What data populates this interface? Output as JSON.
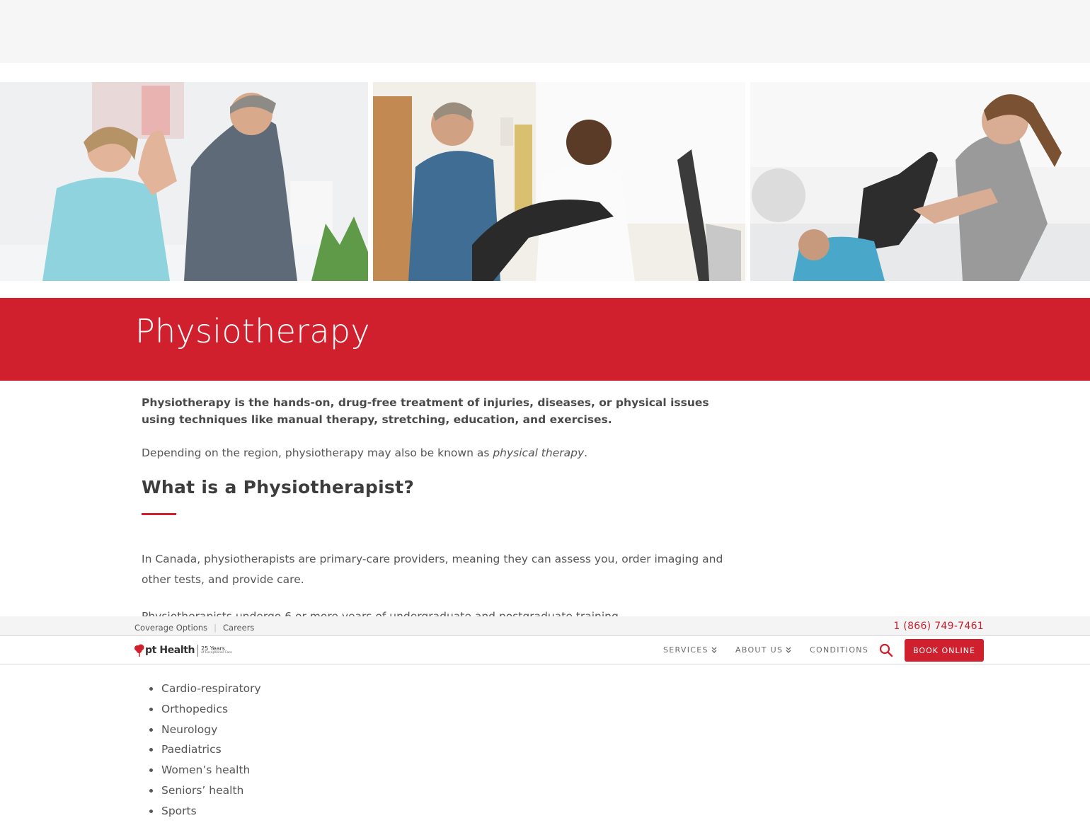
{
  "hero": {
    "images": [
      {
        "name": "physiotherapist-shoulder-stretch-photo"
      },
      {
        "name": "treadmill-assessment-photo"
      },
      {
        "name": "leg-stretch-treatment-photo"
      }
    ]
  },
  "page": {
    "title": "Physiotherapy",
    "lead": "Physiotherapy is the hands-on, drug-free treatment of injuries, diseases, or physical issues using techniques like manual therapy, stretching, education, and exercises.",
    "p1_before": "Depending on the region, physiotherapy may also be known as ",
    "p1_em": "physical therapy",
    "p1_after": ".",
    "h2": "What is a Physiotherapist?",
    "p2": "In Canada, physiotherapists are primary-care providers, meaning they can assess you, order imaging and other tests, and provide care.",
    "p3": "Physiotherapists undergo 6 or more years of undergraduate and postgraduate training",
    "list": [
      "Cardio-respiratory",
      "Orthopedics",
      "Neurology",
      "Paediatrics",
      "Women’s health",
      "Seniors’ health",
      "Sports"
    ]
  },
  "utility": {
    "links": [
      "Coverage Options",
      "Careers"
    ],
    "phone": "1 (866) 749-7461"
  },
  "nav": {
    "logo_name": "pt Health",
    "logo_years": "25 Years",
    "logo_tagline": "of Exceptional Care",
    "items": [
      "SERVICES",
      "ABOUT US",
      "CONDITIONS"
    ],
    "book": "BOOK ONLINE"
  },
  "colors": {
    "brand_red": "#d0202e",
    "text": "#4a4a4a"
  },
  "icons": [
    "chevron-double-down-icon",
    "search-icon",
    "tree-logo-icon"
  ]
}
